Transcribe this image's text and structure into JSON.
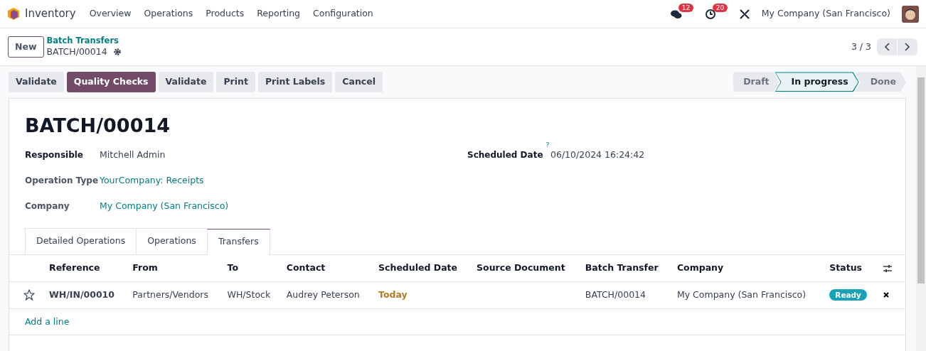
{
  "navbar": {
    "app": "Inventory",
    "menu": [
      "Overview",
      "Operations",
      "Products",
      "Reporting",
      "Configuration"
    ],
    "messages_count": "12",
    "activities_count": "20",
    "company": "My Company (San Francisco)"
  },
  "control_panel": {
    "new_button": "New",
    "breadcrumb": "Batch Transfers",
    "record": "BATCH/00014",
    "pager": "3 / 3"
  },
  "actions": [
    {
      "label": "Validate",
      "kind": "secondary"
    },
    {
      "label": "Quality Checks",
      "kind": "primary"
    },
    {
      "label": "Validate",
      "kind": "secondary"
    },
    {
      "label": "Print",
      "kind": "secondary"
    },
    {
      "label": "Print Labels",
      "kind": "secondary"
    },
    {
      "label": "Cancel",
      "kind": "secondary"
    }
  ],
  "status_steps": [
    {
      "label": "Draft",
      "selected": false
    },
    {
      "label": "In progress",
      "selected": true
    },
    {
      "label": "Done",
      "selected": false
    }
  ],
  "form": {
    "title": "BATCH/00014",
    "left_fields": [
      {
        "label": "Responsible",
        "required": true,
        "value": "Mitchell Admin",
        "kind": "text"
      },
      {
        "label": "Operation Type",
        "required": false,
        "value": "YourCompany: Receipts",
        "kind": "link"
      },
      {
        "label": "Company",
        "required": false,
        "value": "My Company (San Francisco)",
        "kind": "link"
      }
    ],
    "right_fields": [
      {
        "label": "Scheduled Date",
        "required": true,
        "help": "?",
        "value": "06/10/2024 16:24:42",
        "kind": "text"
      }
    ]
  },
  "tabs": [
    {
      "label": "Detailed Operations",
      "selected": false
    },
    {
      "label": "Operations",
      "selected": false
    },
    {
      "label": "Transfers",
      "selected": true
    }
  ],
  "table": {
    "columns": [
      "Reference",
      "From",
      "To",
      "Contact",
      "Scheduled Date",
      "Source Document",
      "Batch Transfer",
      "Company",
      "Status"
    ],
    "rows": [
      {
        "starred": false,
        "reference": "WH/IN/00010",
        "from": "Partners/Vendors",
        "to": "WH/Stock",
        "contact": "Audrey Peterson",
        "scheduled_date": "Today",
        "batch_transfer": "BATCH/00014",
        "company": "My Company (San Francisco)",
        "status": "Ready"
      }
    ],
    "add_line": "Add a line"
  }
}
